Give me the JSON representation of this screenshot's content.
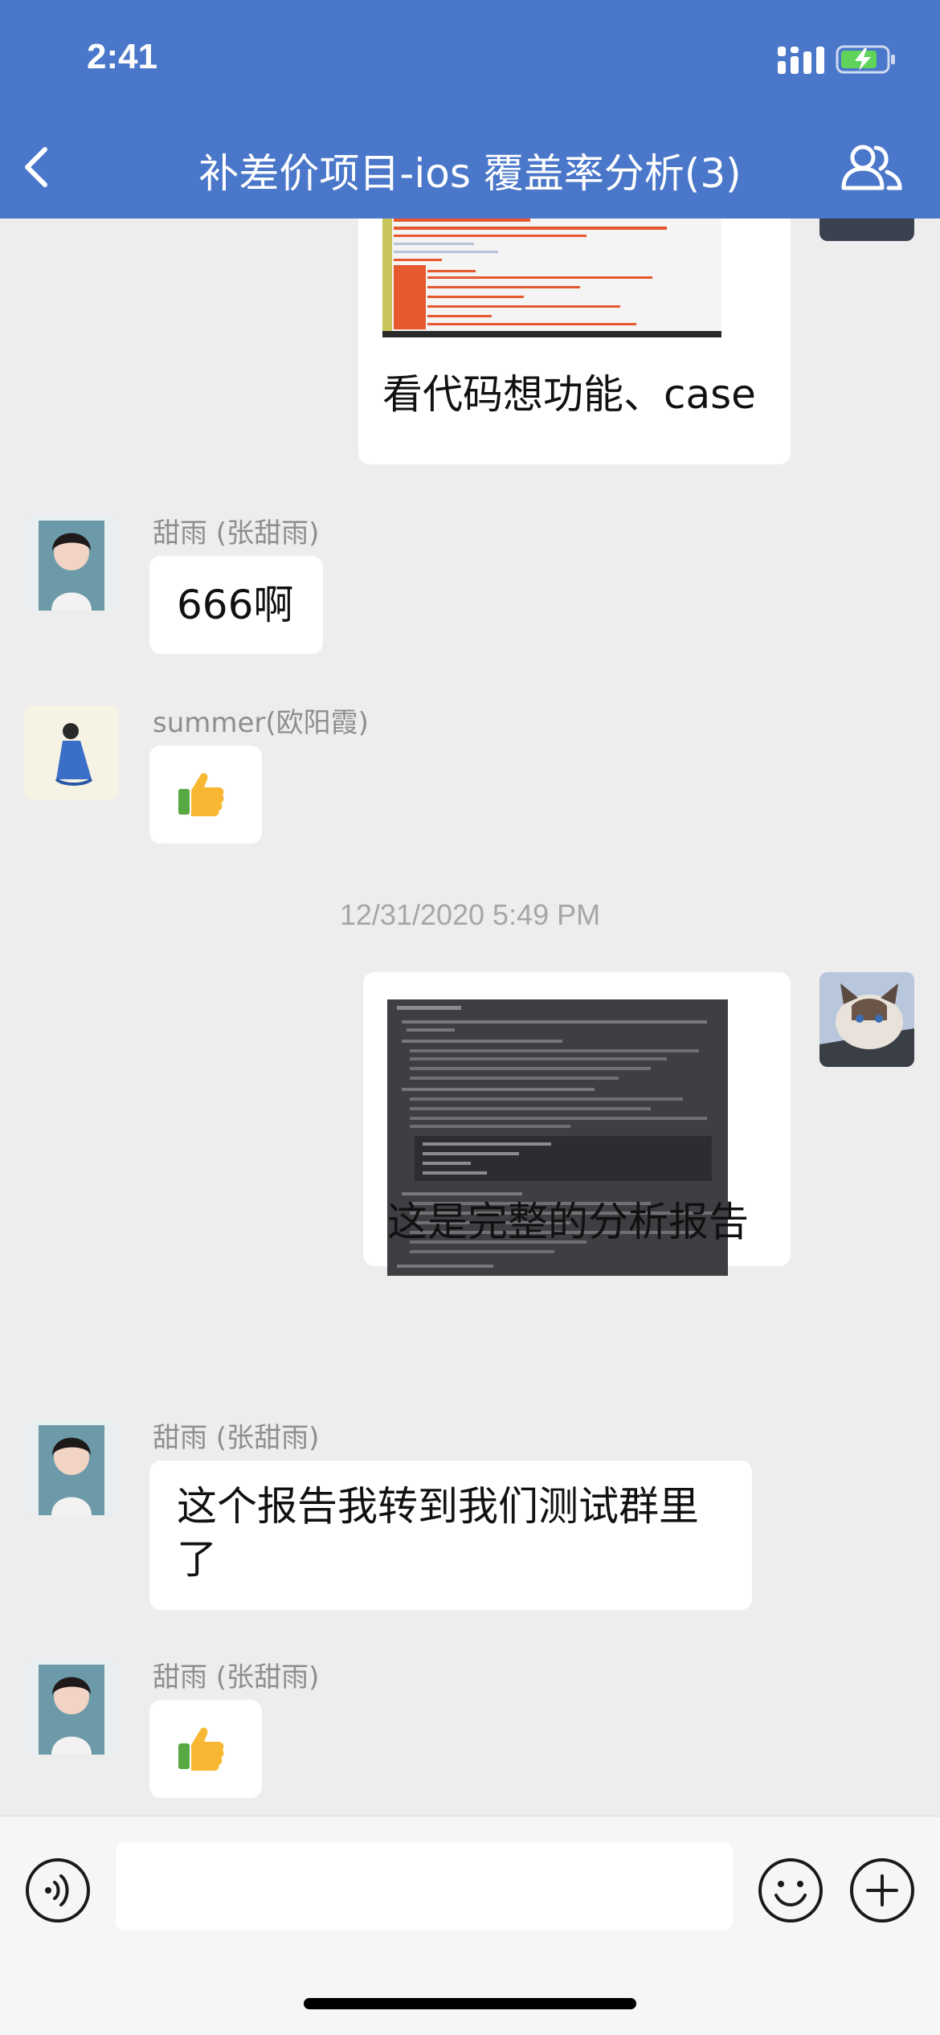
{
  "status_bar": {
    "time": "2:41"
  },
  "nav": {
    "title": "补差价项目-ios 覆盖率分析(3)"
  },
  "messages": [
    {
      "id": "m0",
      "side": "right",
      "type": "image_text",
      "caption": "看代码想功能、case"
    },
    {
      "id": "m1",
      "side": "left",
      "sender": "甜雨 (张甜雨)",
      "type": "text",
      "text": "666啊"
    },
    {
      "id": "m2",
      "side": "left",
      "sender": "summer(欧阳霞)",
      "type": "sticker",
      "sticker": "thumbs-up"
    },
    {
      "id": "m3",
      "type": "timestamp",
      "text": "12/31/2020 5:49 PM"
    },
    {
      "id": "m4",
      "side": "right",
      "type": "image_text",
      "caption": "这是完整的分析报告"
    },
    {
      "id": "m5",
      "side": "left",
      "sender": "甜雨 (张甜雨)",
      "type": "text",
      "text": "这个报告我转到我们测试群里了"
    },
    {
      "id": "m6",
      "side": "left",
      "sender": "甜雨 (张甜雨)",
      "type": "sticker",
      "sticker": "thumbs-up"
    }
  ],
  "colors": {
    "header": "#4a77c9",
    "background": "#ededed",
    "bubble": "#ffffff"
  }
}
